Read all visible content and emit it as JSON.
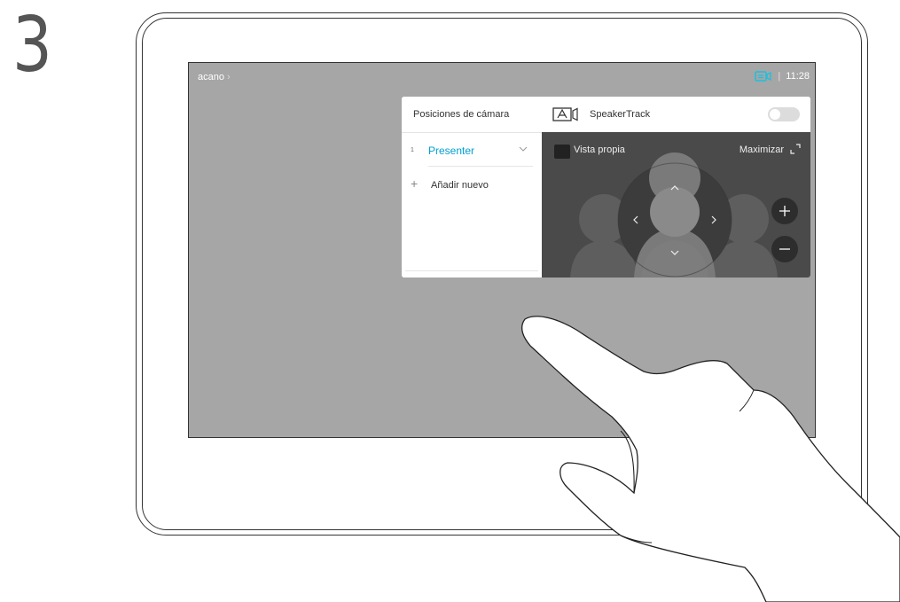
{
  "step": {
    "number": "3"
  },
  "topbar": {
    "breadcrumb": "acano",
    "breadcrumb_chevron": "›",
    "camera_status_icon": "camera-status-icon",
    "separator": "|",
    "time": "11:28"
  },
  "camera_panel": {
    "presets_title": "Posiciones de cámara",
    "presets": [
      {
        "index": "1",
        "name": "Presenter"
      }
    ],
    "add_new_label": "Añadir nuevo",
    "speakertrack_label": "SpeakerTrack",
    "speakertrack_enabled": false,
    "selfview_label": "Vista propia",
    "maximize_label": "Maximizar",
    "controls": {
      "up": "up-arrow-icon",
      "down": "down-arrow-icon",
      "left": "left-arrow-icon",
      "right": "right-arrow-icon",
      "zoom_in": "plus-icon",
      "zoom_out": "minus-icon"
    }
  },
  "colors": {
    "screen_bg": "#a6a6a6",
    "accent": "#00a0d1",
    "view_bg": "#4a4a4a"
  }
}
